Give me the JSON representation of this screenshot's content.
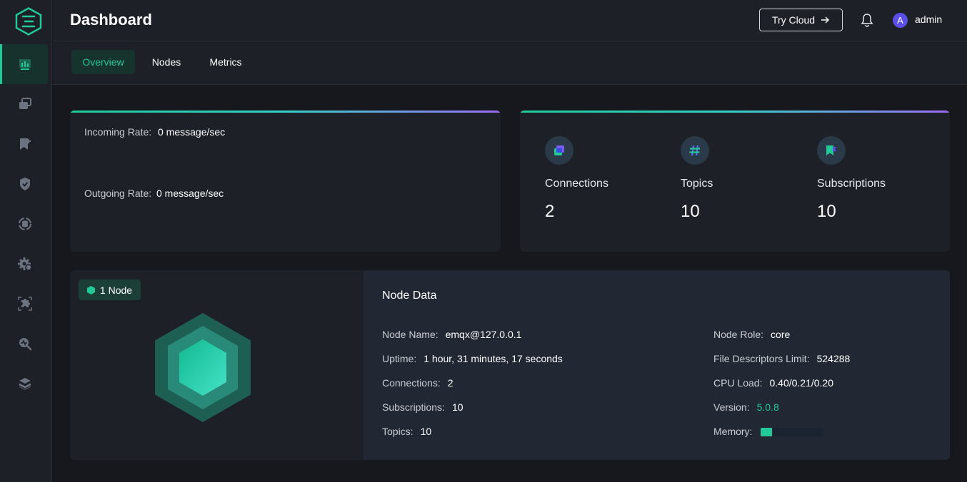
{
  "header": {
    "title": "Dashboard",
    "try_cloud_label": "Try Cloud",
    "avatar_initial": "A",
    "username": "admin"
  },
  "sidebar": {
    "items": [
      {
        "icon": "dashboard-chart-icon",
        "active": true
      },
      {
        "icon": "clients-windows-icon",
        "active": false
      },
      {
        "icon": "subscriptions-bookmark-icon",
        "active": false
      },
      {
        "icon": "access-control-shield-icon",
        "active": false
      },
      {
        "icon": "integration-data-icon",
        "active": false
      },
      {
        "icon": "management-gear-icon",
        "active": false
      },
      {
        "icon": "extensions-puzzle-icon",
        "active": false
      },
      {
        "icon": "diagnose-search-icon",
        "active": false
      },
      {
        "icon": "system-layers-icon",
        "active": false
      }
    ]
  },
  "tabs": [
    {
      "label": "Overview",
      "active": true
    },
    {
      "label": "Nodes",
      "active": false
    },
    {
      "label": "Metrics",
      "active": false
    }
  ],
  "rates": {
    "incoming_label": "Incoming Rate:",
    "incoming_value": "0 message/sec",
    "outgoing_label": "Outgoing Rate:",
    "outgoing_value": "0 message/sec"
  },
  "stats": [
    {
      "label": "Connections",
      "value": "2",
      "icon": "connections-icon"
    },
    {
      "label": "Topics",
      "value": "10",
      "icon": "hash-icon"
    },
    {
      "label": "Subscriptions",
      "value": "10",
      "icon": "subscription-flag-icon"
    }
  ],
  "node": {
    "badge": "1 Node",
    "data_title": "Node Data",
    "left_fields": [
      {
        "label": "Node Name:",
        "value": "emqx@127.0.0.1"
      },
      {
        "label": "Uptime:",
        "value": "1 hour, 31 minutes, 17 seconds"
      },
      {
        "label": "Connections:",
        "value": "2"
      },
      {
        "label": "Subscriptions:",
        "value": "10"
      },
      {
        "label": "Topics:",
        "value": "10"
      }
    ],
    "right_fields": [
      {
        "label": "Node Role:",
        "value": "core"
      },
      {
        "label": "File Descriptors Limit:",
        "value": "524288"
      },
      {
        "label": "CPU Load:",
        "value": "0.40/0.21/0.20"
      },
      {
        "label": "Version:",
        "value": "5.0.8"
      }
    ],
    "memory_label": "Memory:",
    "memory_fraction": 0.18
  },
  "colors": {
    "accent": "#20c997",
    "background": "#16181d",
    "panel": "#1d2027",
    "avatar": "#5b4fe8"
  }
}
